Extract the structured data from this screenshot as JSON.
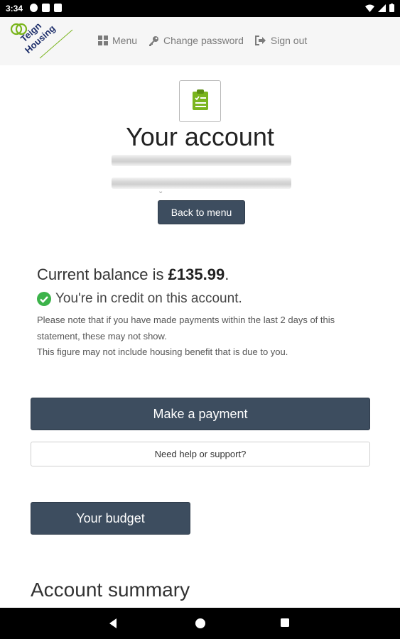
{
  "status_bar": {
    "time": "3:34"
  },
  "header": {
    "logo_text": "Teign Housing",
    "nav": [
      {
        "label": "Menu",
        "icon": "grid-icon"
      },
      {
        "label": "Change password",
        "icon": "key-icon"
      },
      {
        "label": "Sign out",
        "icon": "sign-out-icon"
      }
    ]
  },
  "main": {
    "title": "Your account",
    "back_button": "Back to menu",
    "balance_prefix": "Current balance is ",
    "balance_amount": "£135.99",
    "balance_suffix": ".",
    "credit_text": "You're in credit on this account.",
    "note_1": "Please note that if you have made payments within the last 2 days of this statement, these may not show.",
    "note_2": "This figure may not include housing benefit that is due to you.",
    "pay_button": "Make a payment",
    "help_button": "Need help or support?",
    "budget_button": "Your budget",
    "summary_heading": "Account summary"
  },
  "colors": {
    "primary_button": "#3d4d5f",
    "accent_green": "#7ab51d",
    "success_green": "#3cb34a"
  }
}
